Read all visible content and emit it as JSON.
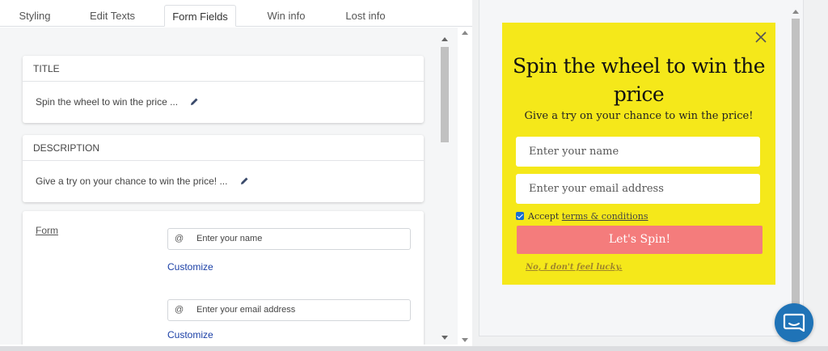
{
  "tabs": [
    {
      "label": "Styling"
    },
    {
      "label": "Edit Texts"
    },
    {
      "label": "Form Fields"
    },
    {
      "label": "Win info"
    },
    {
      "label": "Lost info"
    }
  ],
  "active_tab": "Form Fields",
  "cards": {
    "title": {
      "header": "TITLE",
      "value": "Spin the wheel to win the price ..."
    },
    "description": {
      "header": "DESCRIPTION",
      "value": "Give a try on your chance to win the price! ..."
    },
    "form": {
      "label": "Form",
      "fields": [
        {
          "icon": "@",
          "placeholder": "Enter your name",
          "customize": "Customize"
        },
        {
          "icon": "@",
          "placeholder": "Enter your email address",
          "customize": "Customize"
        }
      ]
    }
  },
  "preview": {
    "title": "Spin the wheel to win the price",
    "description": "Give a try on your chance to win the price!",
    "name_placeholder": "Enter your name",
    "email_placeholder": "Enter your email address",
    "accept_prefix": "Accept",
    "accept_link": "terms & conditions",
    "button_label": "Let's Spin!",
    "decline_label": "No, I don't feel lucky.",
    "colors": {
      "background": "#f5e81a",
      "button": "#f47c7c"
    }
  },
  "chat": {
    "icon": "chat-icon"
  }
}
